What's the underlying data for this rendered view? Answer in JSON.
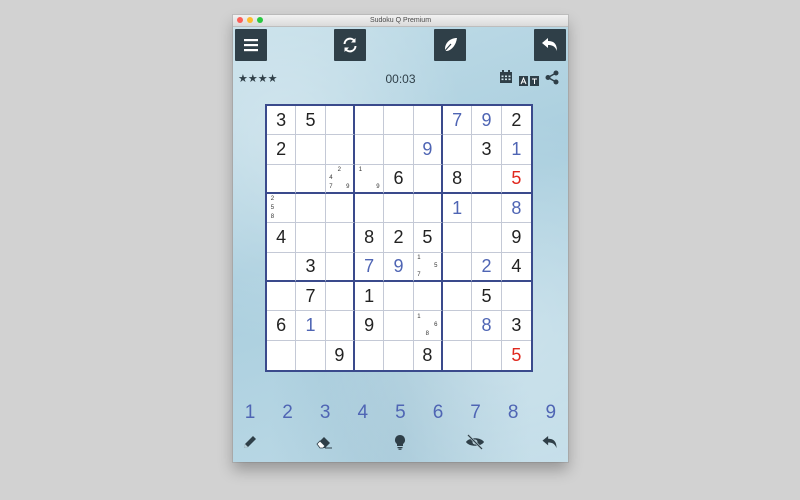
{
  "window": {
    "title": "Sudoku Q Premium"
  },
  "status": {
    "stars": "★★★★",
    "timer": "00:03"
  },
  "icons": {
    "menu": "menu-icon",
    "new_game": "refresh-icon",
    "notes": "feather-icon",
    "undo": "undo-icon",
    "calendar": "calendar-icon",
    "translate": "translate-icon",
    "share": "share-icon",
    "pencil": "pencil-icon",
    "eraser": "eraser-icon",
    "hint": "lightbulb-icon",
    "hide": "eye-slash-icon",
    "undo_bottom": "undo-icon"
  },
  "colors": {
    "toolbar": "#2f3f48",
    "user_digit": "#4f65b4",
    "error_digit": "#e0281e",
    "board_border": "#3a4a8c"
  },
  "board": [
    [
      {
        "v": "3",
        "t": "g"
      },
      {
        "v": "5",
        "t": "g"
      },
      {},
      {},
      {},
      {},
      {
        "v": "7",
        "t": "u"
      },
      {
        "v": "9",
        "t": "u"
      },
      {
        "v": "2",
        "t": "g"
      }
    ],
    [
      {
        "v": "2",
        "t": "g"
      },
      {},
      {},
      {},
      {},
      {
        "v": "9",
        "t": "u"
      },
      {},
      {
        "v": "3",
        "t": "g"
      },
      {
        "v": "1",
        "t": "u"
      }
    ],
    [
      {},
      {},
      {
        "n": [
          "",
          "2",
          "",
          "4",
          "",
          "",
          "7",
          "",
          "9"
        ]
      },
      {
        "n": [
          "1",
          "",
          "",
          "",
          "",
          "",
          "",
          "",
          "9"
        ]
      },
      {
        "v": "6",
        "t": "g"
      },
      {},
      {
        "v": "8",
        "t": "g"
      },
      {},
      {
        "v": "5",
        "t": "e"
      }
    ],
    [
      {
        "n": [
          "2",
          "",
          "",
          "5",
          "",
          "",
          "8",
          "",
          ""
        ]
      },
      {},
      {},
      {},
      {},
      {},
      {
        "v": "1",
        "t": "u"
      },
      {},
      {
        "v": "8",
        "t": "u"
      }
    ],
    [
      {
        "v": "4",
        "t": "g"
      },
      {},
      {},
      {
        "v": "8",
        "t": "g"
      },
      {
        "v": "2",
        "t": "g"
      },
      {
        "v": "5",
        "t": "g"
      },
      {},
      {},
      {
        "v": "9",
        "t": "g"
      }
    ],
    [
      {},
      {
        "v": "3",
        "t": "g"
      },
      {},
      {
        "v": "7",
        "t": "u"
      },
      {
        "v": "9",
        "t": "u"
      },
      {
        "n": [
          "1",
          "",
          "",
          "",
          "",
          "5",
          "7",
          "",
          ""
        ]
      },
      {},
      {
        "v": "2",
        "t": "u"
      },
      {
        "v": "4",
        "t": "g"
      }
    ],
    [
      {},
      {
        "v": "7",
        "t": "g"
      },
      {},
      {
        "v": "1",
        "t": "g"
      },
      {},
      {},
      {},
      {
        "v": "5",
        "t": "g"
      },
      {}
    ],
    [
      {
        "v": "6",
        "t": "g"
      },
      {
        "v": "1",
        "t": "u"
      },
      {},
      {
        "v": "9",
        "t": "g"
      },
      {},
      {
        "n": [
          "1",
          "",
          "",
          "",
          "",
          "6",
          "",
          "8",
          ""
        ]
      },
      {},
      {
        "v": "8",
        "t": "u"
      },
      {
        "v": "3",
        "t": "g"
      }
    ],
    [
      {},
      {},
      {
        "v": "9",
        "t": "g"
      },
      {},
      {},
      {
        "v": "8",
        "t": "g"
      },
      {},
      {},
      {
        "v": "5",
        "t": "e"
      }
    ]
  ],
  "numpad": [
    "1",
    "2",
    "3",
    "4",
    "5",
    "6",
    "7",
    "8",
    "9"
  ]
}
